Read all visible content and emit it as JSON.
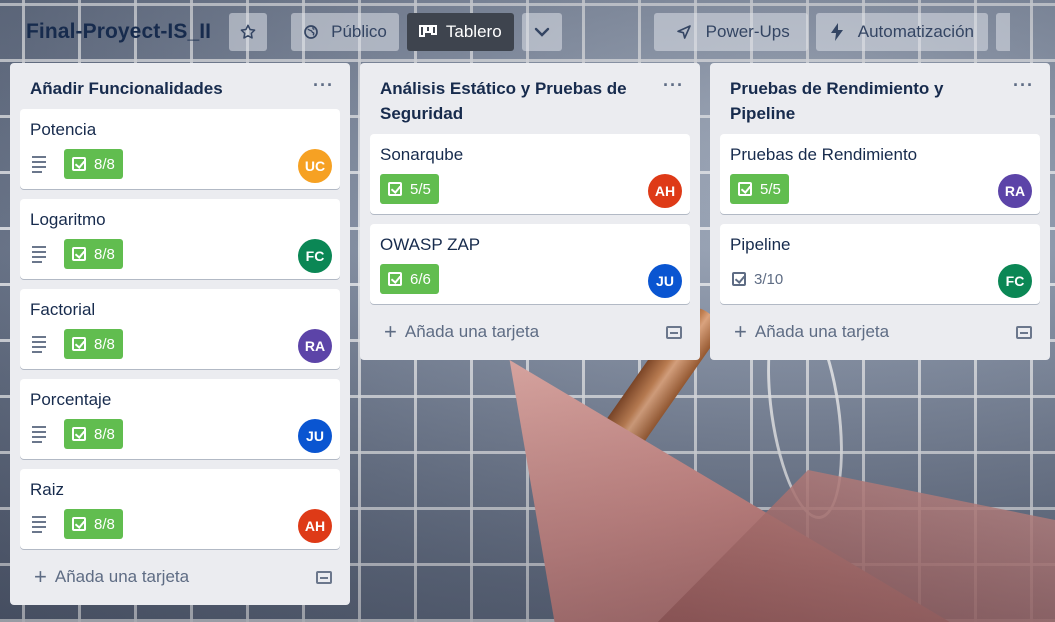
{
  "header": {
    "board_title": "Final-Proyect-IS_II",
    "visibility_label": "Público",
    "view_label": "Tablero",
    "powerups_label": "Power-Ups",
    "automation_label": "Automatización"
  },
  "add_card_label": "Añada una tarjeta",
  "lists": [
    {
      "title": "Añadir Funcionalidades",
      "menu": "···",
      "cards": [
        {
          "title": "Potencia",
          "checklist": "8/8",
          "complete": true,
          "has_description": true,
          "member": "UC",
          "member_color": "#f6a123"
        },
        {
          "title": "Logaritmo",
          "checklist": "8/8",
          "complete": true,
          "has_description": true,
          "member": "FC",
          "member_color": "#0b8755"
        },
        {
          "title": "Factorial",
          "checklist": "8/8",
          "complete": true,
          "has_description": true,
          "member": "RA",
          "member_color": "#5c44a8"
        },
        {
          "title": "Porcentaje",
          "checklist": "8/8",
          "complete": true,
          "has_description": true,
          "member": "JU",
          "member_color": "#0a55d1"
        },
        {
          "title": "Raiz",
          "checklist": "8/8",
          "complete": true,
          "has_description": true,
          "member": "AH",
          "member_color": "#de3a17"
        }
      ]
    },
    {
      "title": "Análisis Estático y Pruebas de Seguridad",
      "menu": "···",
      "cards": [
        {
          "title": "Sonarqube",
          "checklist": "5/5",
          "complete": true,
          "has_description": false,
          "member": "AH",
          "member_color": "#de3a17"
        },
        {
          "title": "OWASP ZAP",
          "checklist": "6/6",
          "complete": true,
          "has_description": false,
          "member": "JU",
          "member_color": "#0a55d1"
        }
      ]
    },
    {
      "title": "Pruebas de Rendimiento y Pipeline",
      "menu": "···",
      "cards": [
        {
          "title": "Pruebas de Rendimiento",
          "checklist": "5/5",
          "complete": true,
          "has_description": false,
          "member": "RA",
          "member_color": "#5c44a8"
        },
        {
          "title": "Pipeline",
          "checklist": "3/10",
          "complete": false,
          "has_description": false,
          "member": "FC",
          "member_color": "#0b8755"
        }
      ]
    }
  ],
  "colors": {
    "checklist_complete": "#61bd4f",
    "list_background": "#ebecf0",
    "title_text": "#172b4d"
  },
  "icons": [
    "star-icon",
    "globe-icon",
    "board-icon",
    "chevron-down-icon",
    "rocket-icon",
    "lightning-icon",
    "description-icon",
    "checklist-icon",
    "plus-icon",
    "card-template-icon",
    "list-menu-icon"
  ]
}
